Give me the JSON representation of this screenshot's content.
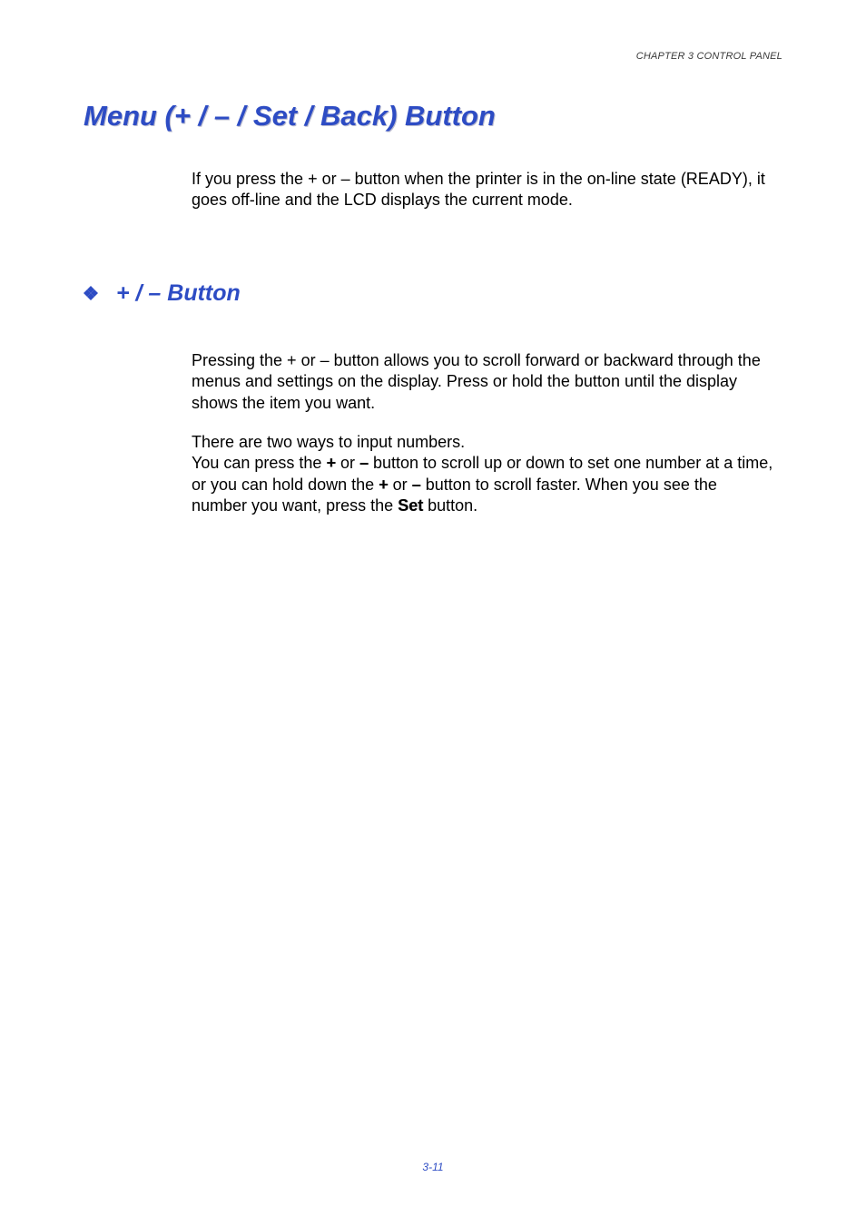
{
  "header": {
    "chapter_label": "CHAPTER 3 CONTROL PANEL"
  },
  "title": "Menu (+ / – / Set / Back) Button",
  "intro": "If you press the + or – button when the printer is in the on-line state (READY), it goes off-line and the LCD displays the current mode.",
  "section": {
    "heading": "+ / – Button",
    "para1": "Pressing the + or  – button allows you to scroll forward or backward through the menus and settings on the display. Press or hold the button  until the display shows the item you want.",
    "para2_a": "There are two ways to input numbers.",
    "para2_b_before": "You can press the ",
    "key_plus": "+",
    "para2_b_mid1": " or ",
    "key_minus": "–",
    "para2_b_mid2": " button to scroll up or down to set one number at a time, or you can hold down the ",
    "para2_b_mid3": " or ",
    "para2_b_mid4": " button to scroll faster.  When you see the number you want, press the ",
    "key_set": "Set",
    "para2_b_end": " button."
  },
  "pagenum": "3-11"
}
